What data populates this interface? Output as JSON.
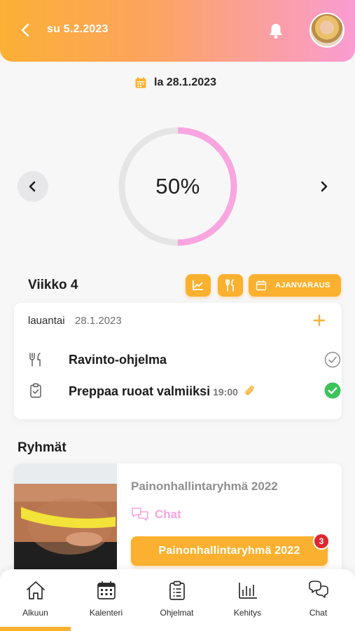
{
  "header": {
    "date": "su 5.2.2023"
  },
  "selected_date": "la 28.1.2023",
  "progress": {
    "percent_text": "50%",
    "value": 0.5
  },
  "week": {
    "title": "Viikko 4",
    "booking_label": "AJANVARAUS"
  },
  "day_card": {
    "day_name": "lauantai",
    "date": "28.1.2023",
    "tasks": [
      {
        "title": "Ravinto-ohjelma",
        "time": "",
        "done": false
      },
      {
        "title": "Preppaa ruoat valmiiksi",
        "time": "19:00",
        "done": true
      }
    ]
  },
  "groups": {
    "title": "Ryhmät",
    "items": [
      {
        "name": "Painonhallintaryhmä 2022",
        "chat_label": "Chat",
        "button_label": "Painonhallintaryhmä 2022",
        "badge": "3"
      }
    ]
  },
  "bottom_nav": [
    {
      "label": "Alkuun",
      "icon": "home-icon",
      "active": true
    },
    {
      "label": "Kalenteri",
      "icon": "calendar-icon",
      "active": false
    },
    {
      "label": "Ohjelmat",
      "icon": "clipboard-icon",
      "active": false
    },
    {
      "label": "Kehitys",
      "icon": "bar-chart-icon",
      "active": false
    },
    {
      "label": "Chat",
      "icon": "chat-icon",
      "active": false
    }
  ],
  "colors": {
    "accent": "#fbb12f",
    "pink": "#f99cd2",
    "success": "#3bc45b",
    "badge": "#e0262f"
  }
}
